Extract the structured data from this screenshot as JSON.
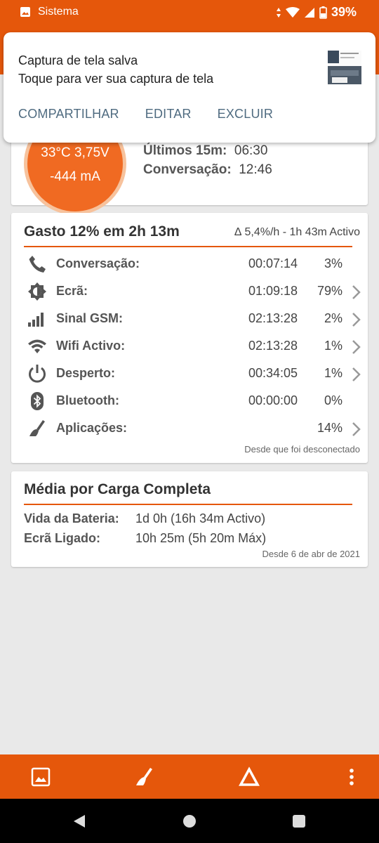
{
  "status_bar": {
    "app_label": "Sistema",
    "battery": "39%"
  },
  "notification": {
    "title": "Captura de tela salva",
    "subtitle": "Toque para ver sua captura de tela",
    "actions": [
      "COMPARTILHAR",
      "EDITAR",
      "EXCLUIR"
    ]
  },
  "battery_summary": {
    "gauge_line1": "33°C  3,75V",
    "gauge_line2": "-444 mA",
    "rows": [
      {
        "label": "Últimos 15m:",
        "value": "06:30"
      },
      {
        "label": "Conversação:",
        "value": "12:46"
      }
    ]
  },
  "usage": {
    "title": "Gasto 12% em 2h 13m",
    "rate": "∆ 5,4%/h - 1h 43m Activo",
    "rows": [
      {
        "label": "Conversação:",
        "time": "00:07:14",
        "pct": "3%"
      },
      {
        "label": "Ecrã:",
        "time": "01:09:18",
        "pct": "79%"
      },
      {
        "label": "Sinal GSM:",
        "time": "02:13:28",
        "pct": "2%"
      },
      {
        "label": "Wifi Activo:",
        "time": "02:13:28",
        "pct": "1%"
      },
      {
        "label": "Desperto:",
        "time": "00:34:05",
        "pct": "1%"
      },
      {
        "label": "Bluetooth:",
        "time": "00:00:00",
        "pct": "0%"
      },
      {
        "label": "Aplicações:",
        "time": "",
        "pct": "14%"
      }
    ],
    "footer": "Desde que foi desconectado"
  },
  "average": {
    "title": "Média por Carga Completa",
    "battery_life_label": "Vida da Bateria:",
    "battery_life_value": "1d 0h (16h 34m Activo)",
    "screen_on_label": "Ecrã Ligado:",
    "screen_on_value": "10h 25m (5h 20m Máx)",
    "footer": "Desde 6 de abr de 2021"
  },
  "colors": {
    "accent": "#e5570b",
    "gauge": "#f06a22",
    "action_text": "#4f6b80"
  },
  "icons": [
    "phone-icon",
    "brightness-icon",
    "signal-icon",
    "wifi-icon",
    "power-icon",
    "bluetooth-icon",
    "broom-icon"
  ]
}
